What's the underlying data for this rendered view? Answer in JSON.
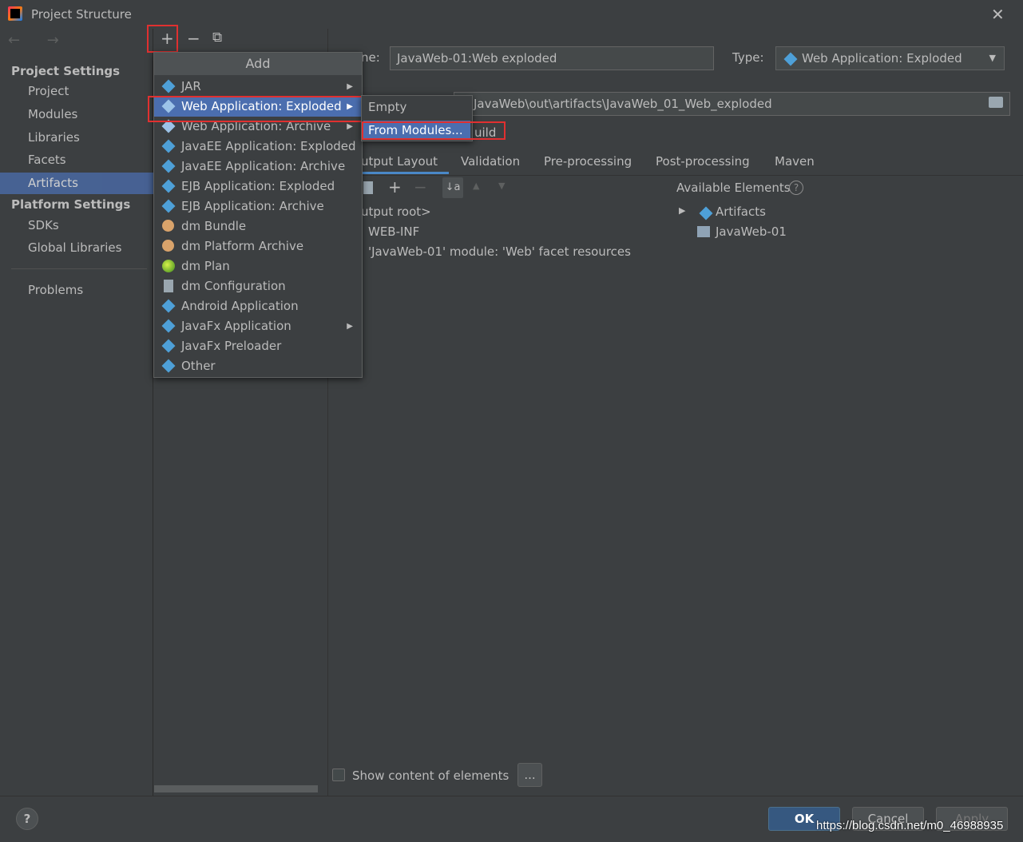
{
  "window": {
    "title": "Project Structure",
    "close_glyph": "✕"
  },
  "nav": {
    "back_forward": "← →",
    "project_settings_label": "Project Settings",
    "project_items": [
      "Project",
      "Modules",
      "Libraries",
      "Facets",
      "Artifacts"
    ],
    "selected_item": "Artifacts",
    "platform_settings_label": "Platform Settings",
    "platform_items": [
      "SDKs",
      "Global Libraries"
    ],
    "problems_label": "Problems"
  },
  "middle_toolbar": {
    "add": "+",
    "remove": "−",
    "copy": "⧉"
  },
  "add_popup": {
    "header": "Add",
    "items": [
      {
        "label": "JAR",
        "icon": "diamond-icon",
        "submenu": true
      },
      {
        "label": "Web Application: Exploded",
        "icon": "web-app-icon",
        "submenu": true,
        "highlighted": true
      },
      {
        "label": "Web Application: Archive",
        "icon": "web-app-icon",
        "submenu": true
      },
      {
        "label": "JavaEE Application: Exploded",
        "icon": "javaee-icon",
        "submenu": false
      },
      {
        "label": "JavaEE Application: Archive",
        "icon": "javaee-icon",
        "submenu": false
      },
      {
        "label": "EJB Application: Exploded",
        "icon": "ejb-icon",
        "submenu": false
      },
      {
        "label": "EJB Application: Archive",
        "icon": "ejb-icon",
        "submenu": false
      },
      {
        "label": "dm Bundle",
        "icon": "dm-bundle-icon",
        "submenu": false
      },
      {
        "label": "dm Platform Archive",
        "icon": "dm-platform-icon",
        "submenu": false
      },
      {
        "label": "dm Plan",
        "icon": "dm-plan-icon",
        "submenu": false
      },
      {
        "label": "dm Configuration",
        "icon": "dm-config-icon",
        "submenu": false
      },
      {
        "label": "Android Application",
        "icon": "diamond-icon",
        "submenu": false
      },
      {
        "label": "JavaFx Application",
        "icon": "diamond-icon",
        "submenu": true
      },
      {
        "label": "JavaFx Preloader",
        "icon": "diamond-icon",
        "submenu": false
      },
      {
        "label": "Other",
        "icon": "diamond-icon",
        "submenu": false
      }
    ]
  },
  "sub_popup": {
    "items": [
      "Empty",
      "From Modules..."
    ]
  },
  "artifact": {
    "name_label": "ne:",
    "name_value": "JavaWeb-01:Web exploded",
    "type_label": "Type:",
    "type_value": "Web Application: Exploded",
    "output_dir": "JavaWeb\\out\\artifacts\\JavaWeb_01_Web_exploded",
    "build_partial": "uild"
  },
  "tabs": [
    "utput Layout",
    "Validation",
    "Pre-processing",
    "Post-processing",
    "Maven"
  ],
  "active_tab": "utput Layout",
  "layout_tree": [
    "utput root>",
    "WEB-INF",
    "'JavaWeb-01' module: 'Web' facet resources"
  ],
  "available": {
    "title": "Available Elements",
    "help": "?",
    "items": [
      "Artifacts",
      "JavaWeb-01"
    ]
  },
  "show_content_label": "Show content of elements",
  "ellipsis_button": "...",
  "buttons": {
    "ok": "OK",
    "cancel": "Cancel",
    "apply": "Apply",
    "help": "?"
  },
  "watermark": "https://blog.csdn.net/m0_46988935",
  "colors": {
    "background": "#3c3f41",
    "selection": "#4b6eaf",
    "accent_red": "#e03030",
    "primary_button": "#365880"
  }
}
